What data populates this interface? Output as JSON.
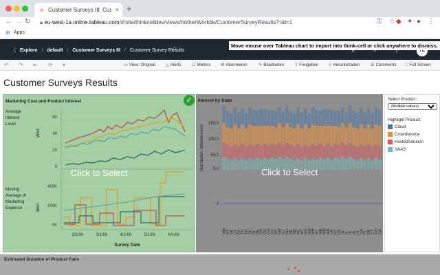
{
  "browser": {
    "tab_title": "Customer Surveys III: Custome",
    "tab_close": "×",
    "new_tab": "+",
    "url_domain": "eu-west-1a.online.tableau.com",
    "url_path": "/#/site/thinkcelldev/views/notherWorkbk/CustomerSurveyResults?:iid=1",
    "bookmarks_label": "Apps",
    "dot_colors": [
      "#ff5f57",
      "#febc2e",
      "#28c840"
    ]
  },
  "header": {
    "crumbs": [
      "Explore",
      "default",
      "Customer Surveys III",
      "Customer Survey Results"
    ],
    "separator": "/",
    "avatar_initials": "TE",
    "banner": "Move mouse over Tableau chart to import into think-cell or click anywhere to dismiss."
  },
  "toolbar": {
    "items": [
      {
        "icon": "▭",
        "label": "View: Original"
      },
      {
        "icon": "△",
        "label": "Alerts"
      },
      {
        "icon": "☐",
        "label": "Metrics"
      },
      {
        "icon": "✉",
        "label": "Abonnieren"
      },
      {
        "icon": "✎",
        "label": "Bearbeiten"
      },
      {
        "icon": "⇪",
        "label": "Freigeben"
      },
      {
        "icon": "⇩",
        "label": "Herunterladen"
      },
      {
        "icon": "☰",
        "label": "Comments"
      },
      {
        "icon": "⛶",
        "label": "Full Screen"
      }
    ]
  },
  "dashboard": {
    "title": "Customer Surveys Results",
    "marketing_panel": {
      "title": "Marketing Cost and Product Interest",
      "overlay": "Click to Select",
      "row1_label": [
        "Average",
        "Interest",
        "Level"
      ],
      "row2_label": [
        "Moving",
        "Average of",
        "Marketing",
        "Expense"
      ],
      "axis_title": "Wert",
      "xlabel": "Survey Date",
      "y1_ticks": [
        "60",
        "40",
        "20",
        "0"
      ],
      "y2_ticks": [
        "400K",
        "200K",
        "0K"
      ],
      "x_ticks": [
        "2/1/08",
        "3/1/08",
        "4/1/08",
        "5/1/08",
        "6/1/08"
      ]
    },
    "state_panel": {
      "title": "Interest by State",
      "overlay": "Click to Select",
      "ylabel": "Durchschn. Interest Level",
      "y_ticks": [
        "150,0",
        "100,0",
        "50,0",
        "0,0"
      ],
      "y_zero_tick": "0",
      "states": [
        "WA",
        "VT",
        "VA",
        "UT",
        "TX",
        "TN",
        "SD",
        "SC",
        "RI",
        "PA",
        "OR",
        "OK",
        "OH",
        "NY",
        "NV",
        "NM",
        "NJ",
        "NH",
        "NE",
        "ND",
        "NC",
        "MT",
        "MS",
        "MO",
        "MN",
        "MI",
        "ME",
        "MD",
        "MA",
        "LA",
        "KY",
        "KS",
        "IN",
        "IL",
        "ID",
        "IA",
        "HI",
        "GA",
        "FL",
        "DE",
        "CT",
        "CO",
        "CA"
      ]
    },
    "filter": {
      "select_label": "Select Product:",
      "select_value": "(Multiple values)",
      "highlight_label": "Highlight Product:",
      "legend": [
        {
          "name": "Cloud",
          "color": "#4e79a7"
        },
        {
          "name": "Crowdsource",
          "color": "#f28e2b"
        },
        {
          "name": "HostedSolution",
          "color": "#e15759"
        },
        {
          "name": "SAAS",
          "color": "#76b7b2"
        }
      ]
    },
    "bottom_panel_title": "Estimated Duration of Product Fads"
  }
}
